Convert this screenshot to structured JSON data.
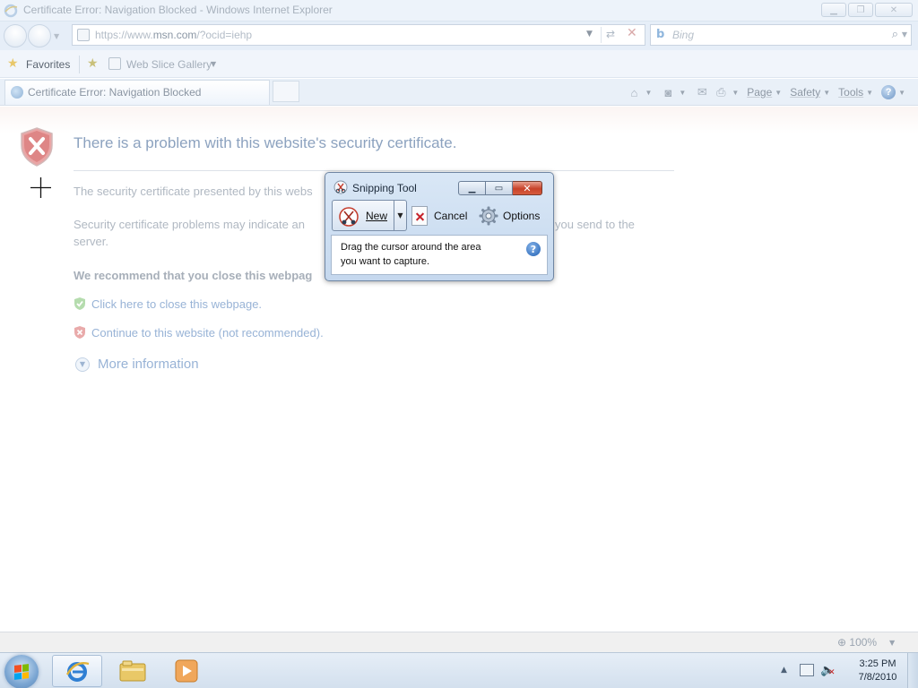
{
  "window": {
    "title": "Certificate Error: Navigation Blocked - Windows Internet Explorer"
  },
  "address_bar": {
    "url_prefix": "https://www.",
    "url_domain": "msn.com",
    "url_suffix": "/?ocid=iehp"
  },
  "search_box": {
    "placeholder": "Bing"
  },
  "favorites_bar": {
    "favorites_label": "Favorites",
    "web_slice_gallery": "Web Slice Gallery"
  },
  "tab": {
    "label": "Certificate Error: Navigation Blocked"
  },
  "command_bar": {
    "page": "Page",
    "safety": "Safety",
    "tools": "Tools",
    "help": "?"
  },
  "content": {
    "heading": "There is a problem with this website's security certificate.",
    "para1": "The security certificate presented by this webs",
    "para2_line1_start": "Security certificate problems may indicate an",
    "para2_line1_end": "you send to the",
    "para2_line2": "server.",
    "recommend": "We recommend that you close this webpag",
    "close_link": "Click here to close this webpage.",
    "continue_link": "Continue to this website (not recommended).",
    "more_info": "More information"
  },
  "snipping_tool": {
    "title": "Snipping Tool",
    "new_label": "New",
    "cancel_label": "Cancel",
    "options_label": "Options",
    "message_line1": "Drag the cursor around the area",
    "message_line2": "you want to capture.",
    "help": "?"
  },
  "status_bar": {
    "zoom": "100%"
  },
  "taskbar": {
    "time": "3:25 PM",
    "date": "7/8/2010"
  },
  "colors": {
    "accent": "#98b3d6",
    "heading": "#8ca2bf",
    "error_red": "#c6232b"
  }
}
